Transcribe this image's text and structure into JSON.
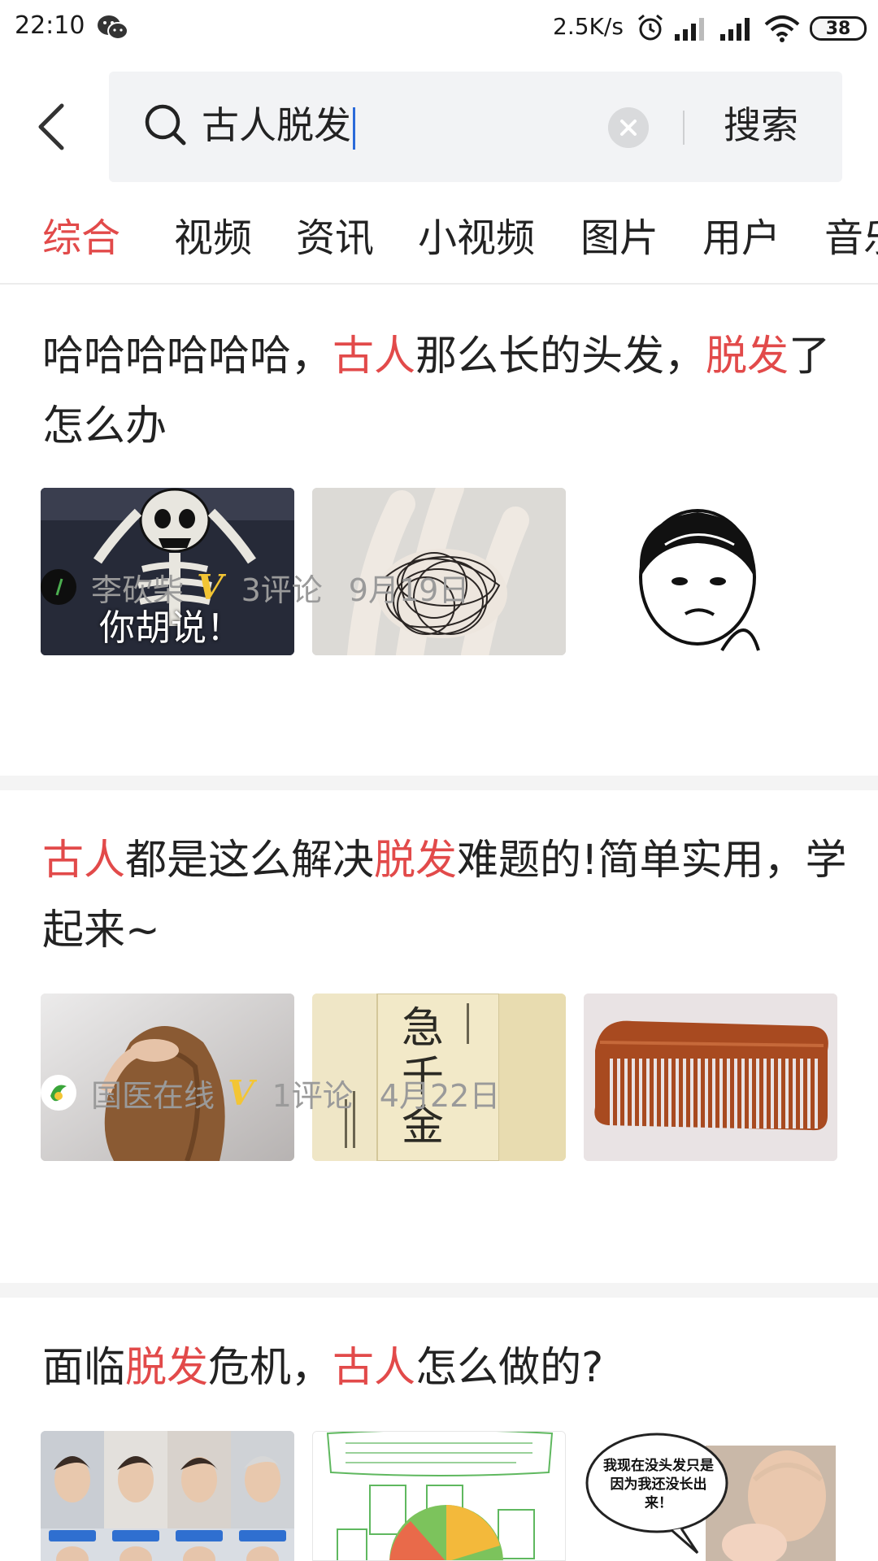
{
  "status_bar": {
    "time": "22:10",
    "net_speed": "2.5K/s",
    "battery": "38",
    "battery_level": 0.38,
    "icons": [
      "wechat-icon",
      "alarm-icon",
      "signal-icon",
      "signal-icon",
      "wifi-icon",
      "battery-icon"
    ]
  },
  "search": {
    "query": "古人脱发",
    "search_button": "搜索"
  },
  "tabs": [
    "综合",
    "视频",
    "资讯",
    "小视频",
    "图片",
    "用户",
    "音乐"
  ],
  "active_tab": "综合",
  "colors": {
    "accent": "#e24a4a",
    "verified_badge": "#f3c534",
    "meta_text": "#9a9a9a",
    "search_bg": "#f2f3f5"
  },
  "articles": [
    {
      "title_parts": [
        "哈哈哈哈哈哈，",
        "古人",
        "那么长的头发，",
        "脱发",
        "了怎么办"
      ],
      "images": [
        "skeleton-meme-image",
        "hair-in-hand-image",
        "balding-cartoon-meme-image"
      ],
      "image_caption": "你胡说！",
      "author": "李砍柴",
      "verified": "V",
      "comments": "3评论",
      "date": "9月19日"
    },
    {
      "title_parts": [
        "古人",
        "都是这么解决",
        "脱发",
        "难题的!简单实用，学起来~"
      ],
      "images": [
        "woman-hair-image",
        "ancient-book-image",
        "wooden-comb-image"
      ],
      "author": "国医在线",
      "verified": "V",
      "comments": "1评论",
      "date": "4月22日"
    },
    {
      "title_parts": [
        "面临",
        "脱发",
        "危机，",
        "古人",
        "怎么做的?"
      ],
      "images": [
        "celebrity-hairline-image",
        "infographic-image",
        "baby-meme-image"
      ],
      "meme_text": "我现在没头发只是因为我还没长出来！"
    }
  ]
}
